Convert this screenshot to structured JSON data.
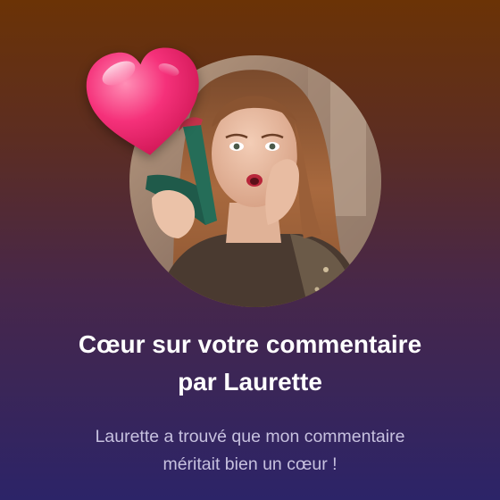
{
  "notification": {
    "title_line1": "Cœur sur votre commentaire",
    "title_line2": "par Laurette",
    "message_line1": "Laurette a trouvé que mon commentaire",
    "message_line2": "méritait bien un cœur !"
  },
  "icons": {
    "reaction": "heart-icon"
  },
  "colors": {
    "heart": "#f0206e",
    "title_text": "#ffffff",
    "message_text": "#c7c1df",
    "gradient_top": "#6b3306",
    "gradient_bottom": "#2c2468"
  }
}
